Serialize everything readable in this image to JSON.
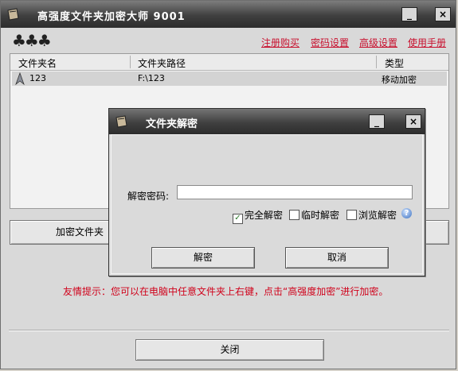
{
  "main": {
    "title": "高强度文件夹加密大师 9001",
    "minimize_label": "_",
    "close_label": "×",
    "decor": "♣♣♣",
    "links": [
      "注册购买",
      "密码设置",
      "高级设置",
      "使用手册"
    ],
    "columns": [
      "文件夹名",
      "文件夹路径",
      "类型"
    ],
    "rows": [
      {
        "name": "123",
        "path": "F:\\123",
        "type": "移动加密"
      }
    ],
    "encrypt_button": "加密文件夹",
    "hint": "友情提示：您可以在电脑中任意文件夹上右键，点击“高强度加密”进行加密。",
    "close_button": "关闭"
  },
  "dialog": {
    "title": "文件夹解密",
    "password_label": "解密密码:",
    "password_value": "",
    "options": [
      {
        "label": "完全解密",
        "checked": true
      },
      {
        "label": "临时解密",
        "checked": false
      },
      {
        "label": "浏览解密",
        "checked": false
      }
    ],
    "help": "?",
    "decrypt_button": "解密",
    "cancel_button": "取消"
  }
}
